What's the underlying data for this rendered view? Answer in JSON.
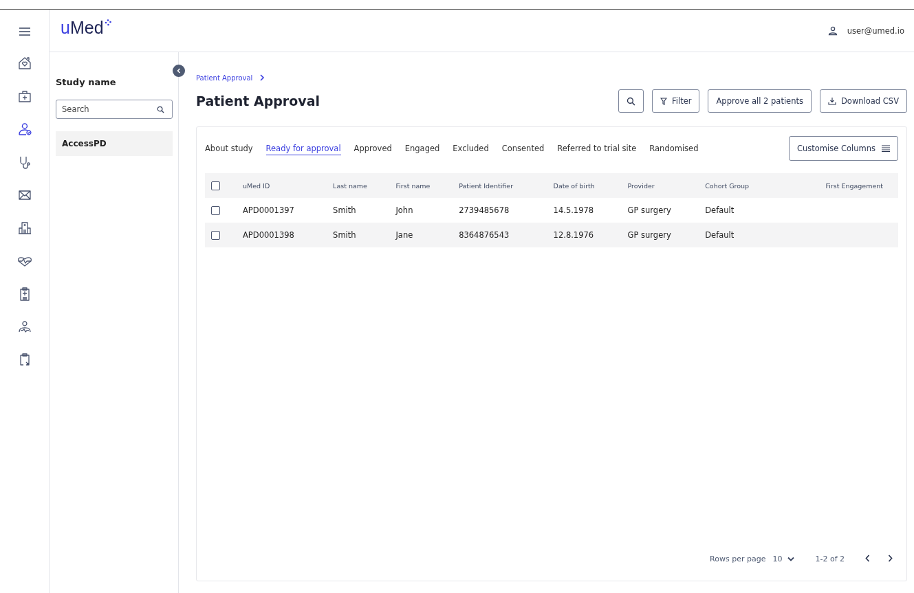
{
  "nav_rail": {
    "items": [
      {
        "selected": false
      },
      {
        "selected": false
      },
      {
        "selected": true
      },
      {
        "selected": false
      },
      {
        "selected": false
      },
      {
        "selected": false
      },
      {
        "selected": false
      },
      {
        "selected": false
      },
      {
        "selected": false
      },
      {
        "selected": false
      }
    ]
  },
  "header": {
    "logo": "uMed",
    "user": "user@umed.io"
  },
  "study_panel": {
    "title": "Study name",
    "search": {
      "placeholder": "Search"
    },
    "studies": [
      {
        "name": "AccessPD",
        "selected": true
      }
    ]
  },
  "breadcrumb": [
    "Patient Approval"
  ],
  "page_title": "Patient Approval",
  "actions": [
    "Filter",
    "Approve all 2 patients",
    "Download CSV"
  ],
  "tabs": [
    {
      "label": "About study",
      "selected": false
    },
    {
      "label": "Ready for approval",
      "selected": true
    },
    {
      "label": "Approved",
      "selected": false
    },
    {
      "label": "Engaged",
      "selected": false
    },
    {
      "label": "Excluded",
      "selected": false
    },
    {
      "label": "Consented",
      "selected": false
    },
    {
      "label": "Referred to trial site",
      "selected": false
    },
    {
      "label": "Randomised",
      "selected": false
    }
  ],
  "customise_button": "Customise Columns",
  "table": {
    "header_checked": false,
    "columns": [
      "uMed ID",
      "Last name",
      "First name",
      "Patient Identifier",
      "Date of birth",
      "Provider",
      "Cohort Group",
      "First Engagement"
    ],
    "rows": [
      {
        "checked": false,
        "cells": [
          "APD0001397",
          "Smith",
          "John",
          "2739485678",
          "14.5.1978",
          "GP surgery",
          "Default",
          ""
        ]
      },
      {
        "checked": false,
        "cells": [
          "APD0001398",
          "Smith",
          "Jane",
          "8364876543",
          "12.8.1976",
          "GP surgery",
          "Default",
          ""
        ]
      }
    ]
  },
  "pagination": {
    "rows_per_page_label": "Rows per page",
    "rows_per_page": "10",
    "range": "1-2 of 2"
  }
}
